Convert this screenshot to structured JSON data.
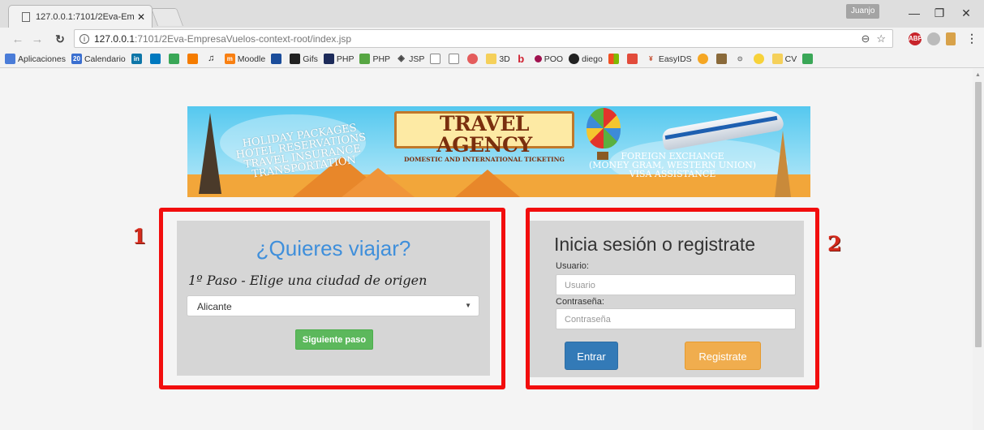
{
  "browser": {
    "tab_title": "127.0.0.1:7101/2Eva-Emp",
    "user": "Juanjo",
    "url_host": "127.0.0.1",
    "url_path": ":7101/2Eva-EmpresaVuelos-context-root/index.jsp",
    "bookmarks": [
      "Aplicaciones",
      "Calendario",
      "",
      "",
      "",
      "",
      "",
      "Moodle",
      "",
      "Gifs",
      "PHP",
      "PHP",
      "JSP",
      "",
      "",
      "",
      "3D",
      "",
      "POO",
      "diego",
      "",
      "",
      "EasyIDS",
      "",
      "",
      "",
      "",
      "CV",
      ""
    ]
  },
  "banner": {
    "sign_title": "TRAVEL AGENCY",
    "sign_subtitle": "DOMESTIC AND INTERNATIONAL TICKETING",
    "left_lines": [
      "HOLIDAY PACKAGES",
      "HOTEL RESERVATIONS",
      "TRAVEL INSURANCE",
      "TRANSPORTATION"
    ],
    "right_lines": [
      "FOREIGN EXCHANGE",
      "(MONEY GRAM, WESTERN UNION)",
      "VISA ASSISTANCE"
    ]
  },
  "annotations": {
    "left_number": "1",
    "right_number": "2"
  },
  "travel": {
    "title": "¿Quieres viajar?",
    "step": "1º Paso - Elige una ciudad de origen",
    "selected_city": "Alicante",
    "next_button": "Siguiente paso"
  },
  "login": {
    "title": "Inicia sesión o registrate",
    "user_label": "Usuario:",
    "user_placeholder": "Usuario",
    "password_label": "Contraseña:",
    "password_placeholder": "Contraseña",
    "login_button": "Entrar",
    "register_button": "Registrate"
  },
  "colors": {
    "accent_blue": "#3f8fdb",
    "highlight_red": "#f20d0d",
    "success_green": "#5cb85c",
    "primary_blue": "#337ab7",
    "warning_orange": "#f0ad4e"
  }
}
